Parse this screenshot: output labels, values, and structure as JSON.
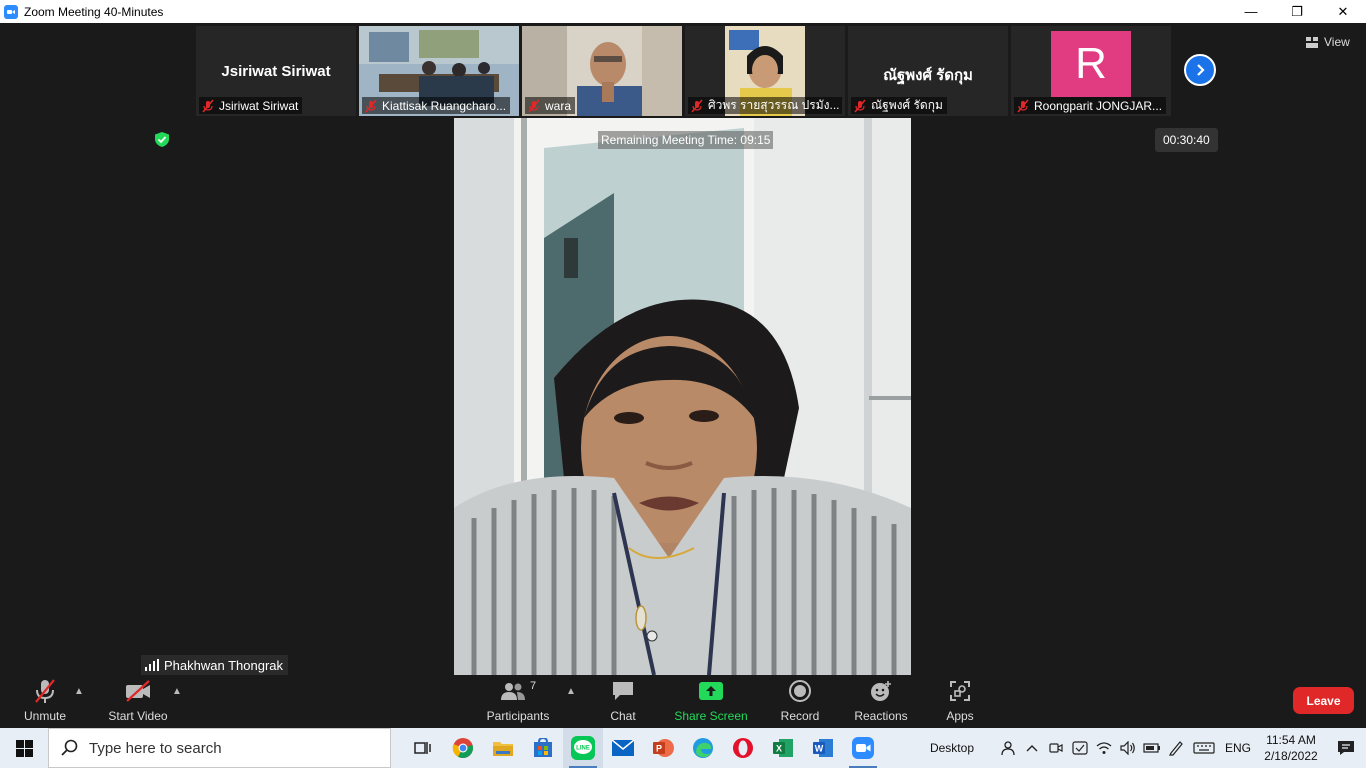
{
  "window": {
    "title": "Zoom Meeting 40-Minutes",
    "controls": {
      "minimize": "—",
      "restore": "❐",
      "close": "✕"
    }
  },
  "gallery": {
    "tiles": [
      {
        "big_name": "Jsiriwat Siriwat",
        "label": "Jsiriwat Siriwat",
        "type": "name"
      },
      {
        "big_name": "",
        "label": "Kiattisak Ruangcharo...",
        "type": "video"
      },
      {
        "big_name": "",
        "label": "wara",
        "type": "video"
      },
      {
        "big_name": "",
        "label": "ศิวพร  รายสุวรรณ ปรมัง...",
        "type": "video"
      },
      {
        "big_name": "ณัฐพงศ์ รัดกุม",
        "label": "ณัฐพงศ์ รัดกุม",
        "type": "name"
      },
      {
        "big_name": "R",
        "label": "Roongparit JONGJAR...",
        "type": "avatar"
      }
    ],
    "view_label": "View"
  },
  "meeting": {
    "remaining_time_text": "Remaining Meeting Time: 09:15",
    "elapsed_timer": "00:30:40",
    "active_speaker": "Phakhwan Thongrak"
  },
  "toolbar": {
    "unmute": "Unmute",
    "start_video": "Start Video",
    "participants": "Participants",
    "participants_count": "7",
    "chat": "Chat",
    "share_screen": "Share Screen",
    "record": "Record",
    "reactions": "Reactions",
    "apps": "Apps",
    "leave": "Leave"
  },
  "taskbar": {
    "search_placeholder": "Type here to search",
    "desktop_label": "Desktop",
    "language": "ENG",
    "time": "11:54 AM",
    "date": "2/18/2022"
  },
  "colors": {
    "accent_blue": "#2d8cff",
    "leave_red": "#e02828",
    "share_green": "#23d959",
    "avatar_pink": "#e13c82"
  }
}
